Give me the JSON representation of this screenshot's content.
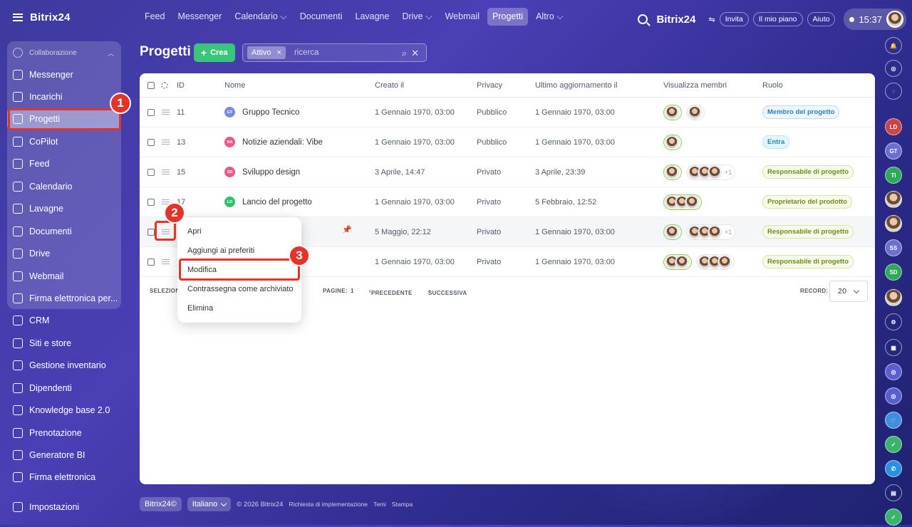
{
  "app": {
    "menu_icon": "hamburger-icon",
    "logo": "Bitrix24",
    "logo_mark": "©"
  },
  "topnav": [
    "Feed",
    "Messenger",
    "Calendario ⌵",
    "Documenti",
    "Lavagne",
    "Drive ⌵",
    "Webmail",
    "Progetti",
    "Altro ⌵"
  ],
  "topright": {
    "logo": "Bitrix24",
    "invite": "Invita",
    "plan": "Il mio piano",
    "help": "Aiuto",
    "time": "15:37"
  },
  "sidebar": {
    "group": "Collaborazione",
    "items": [
      "Messenger",
      "Incarichi",
      "Progetti",
      "CoPilot",
      "Feed",
      "Calendario",
      "Lavagne",
      "Documenti",
      "Drive",
      "Webmail",
      "Firma elettronica per...",
      "CRM",
      "Siti e store",
      "Gestione inventario",
      "Dipendenti",
      "Knowledge base 2.0",
      "Prenotazione",
      "Generatore BI",
      "Firma elettronica",
      "Impostazioni"
    ],
    "active": "Progetti"
  },
  "page": {
    "title": "Progetti",
    "create_label": "Crea",
    "filter_chip": "Attivo",
    "search_placeholder": "ricerca"
  },
  "table": {
    "headers": [
      "ID",
      "Nome",
      "Creato il",
      "Privacy",
      "Ultimo aggiornamento il",
      "Visualizza membri",
      "Ruolo"
    ],
    "rows": [
      {
        "id": "11",
        "icon": "GT",
        "icon_color": "#7c86e6",
        "name": "Gruppo Tecnico",
        "created": "1 Gennaio 1970, 03:00",
        "privacy": "Pubblico",
        "updated": "1 Gennaio 1970, 03:00",
        "more": "",
        "role": "Membro del progetto",
        "role_style": "blue"
      },
      {
        "id": "13",
        "icon": "NA",
        "icon_color": "#f0568a",
        "name": "Notizie aziendali: Vibe",
        "created": "1 Gennaio 1970, 03:00",
        "privacy": "Pubblico",
        "updated": "1 Gennaio 1970, 03:00",
        "more": "",
        "role": "Entra",
        "role_style": "teal"
      },
      {
        "id": "15",
        "icon": "SD",
        "icon_color": "#f0568a",
        "name": "Sviluppo design",
        "created": "3 Aprile, 14:47",
        "privacy": "Privato",
        "updated": "3 Aprile, 23:39",
        "more": "+1",
        "role": "Responsabile di progetto",
        "role_style": "green"
      },
      {
        "id": "17",
        "icon": "LD",
        "icon_color": "#2fc26e",
        "name": "Lancio del progetto",
        "created": "1 Gennaio 1970, 03:00",
        "privacy": "Privato",
        "updated": "5 Febbraio, 12:52",
        "more": "",
        "role": "Proprietario del prodotto",
        "role_style": "green"
      },
      {
        "id": "",
        "icon": "",
        "icon_color": "",
        "name": "",
        "created": "5 Maggio, 22:12",
        "privacy": "Privato",
        "updated": "1 Gennaio 1970, 03:00",
        "more": "+1",
        "role": "Responsabile di progetto",
        "role_style": "green"
      },
      {
        "id": "",
        "icon": "",
        "icon_color": "",
        "name": "",
        "created": "1 Gennaio 1970, 03:00",
        "privacy": "Privato",
        "updated": "1 Gennaio 1970, 03:00",
        "more": "",
        "role": "Responsabile di progetto",
        "role_style": "green"
      }
    ]
  },
  "footer_bar": {
    "selected": "SELEZIONATI",
    "pages_label": "PAGINE:",
    "page": "1",
    "prev": "PRECEDENTE",
    "next": "SUCCESSIVA",
    "records_label": "RECORD:",
    "records": "20"
  },
  "context_menu": [
    "Apri",
    "Aggiungi ai preferiti",
    "Modifica",
    "Contrassegna come archiviato",
    "Elimina"
  ],
  "callouts": [
    "1",
    "2",
    "3"
  ],
  "bottom": {
    "brand": "Bitrix24©",
    "language": "Italiano",
    "copyright": "© 2026 Bitrix24",
    "impl": "Richiesta di implementazione",
    "themes": "Temi",
    "print": "Stampa"
  },
  "rightrail_labels": [
    "LD",
    "GT",
    "TI",
    "SS",
    "SD"
  ],
  "colors": {
    "accent_green": "#3bc57a",
    "highlight_red": "#e5332a"
  }
}
